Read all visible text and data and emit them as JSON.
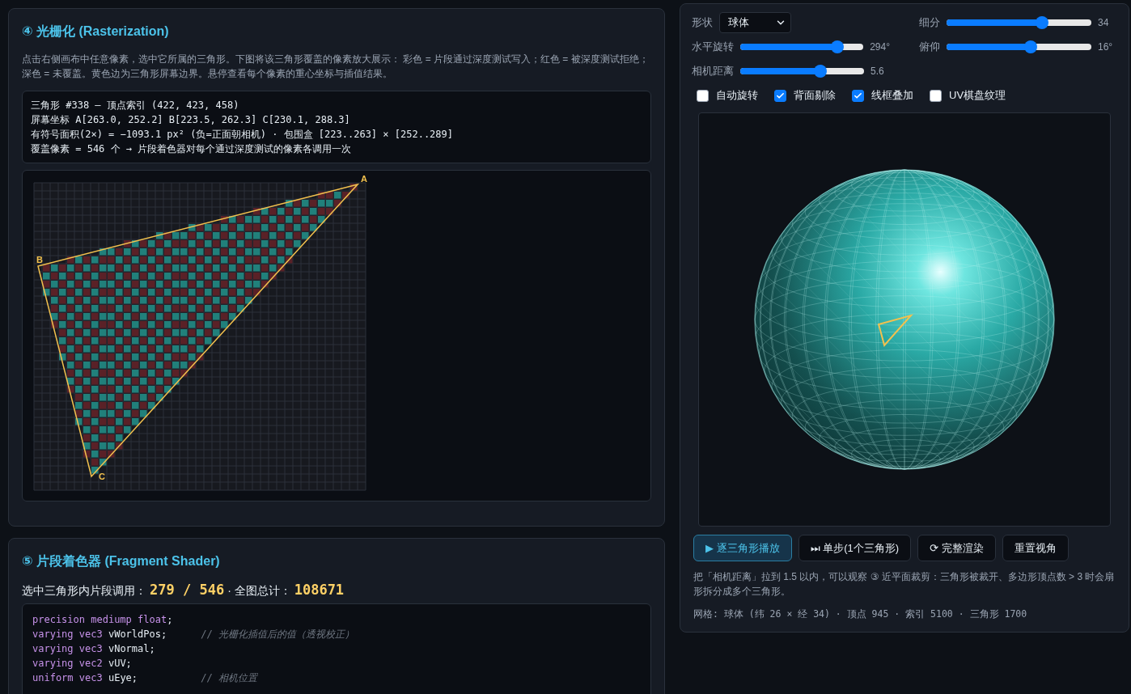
{
  "rasterization": {
    "title": "④ 光栅化 (Rasterization)",
    "description": "点击右侧画布中任意像素，选中它所属的三角形。下图将该三角形覆盖的像素放大展示： 彩色 = 片段通过深度测试写入；红色 = 被深度测试拒绝；深色 = 未覆盖。黄色边为三角形屏幕边界。悬停查看每个像素的重心坐标与插值结果。",
    "info_lines": [
      "三角形 #338 — 顶点索引 (422, 423, 458)",
      "屏幕坐标 A[263.0, 252.2] B[223.5, 262.3] C[230.1, 288.3]",
      "有符号面积(2×) = −1093.1 px² (负=正面朝相机) · 包围盒 [223..263] × [252..289]",
      "覆盖像素 = 546 个 → 片段着色器对每个通过深度测试的像素各调用一次"
    ],
    "vertex_labels": [
      "A",
      "B",
      "C"
    ]
  },
  "fragment_shader": {
    "title": "⑤ 片段着色器 (Fragment Shader)",
    "stats": [
      {
        "kind": "label",
        "text": "选中三角形内片段调用："
      },
      {
        "kind": "value",
        "text": "279 / 546"
      },
      {
        "kind": "label",
        "text": "· 全图总计："
      },
      {
        "kind": "value",
        "text": "108671"
      }
    ],
    "code_lines": [
      {
        "keywords": "precision mediump float",
        "code": ";"
      },
      {
        "keywords": "varying vec3",
        "code": " vWorldPos;",
        "comment": "// 光栅化插值后的值（透视校正）"
      },
      {
        "keywords": "varying vec3",
        "code": " vNormal;"
      },
      {
        "keywords": "varying vec2",
        "code": " vUV;"
      },
      {
        "keywords": "uniform vec3",
        "code": " uEye;",
        "comment": "// 相机位置"
      }
    ]
  },
  "controls": {
    "shape": {
      "label": "形状",
      "value": "球体"
    },
    "sliders": [
      {
        "label": "细分",
        "level": 0.66,
        "reading": "34"
      },
      {
        "label": "水平旋转",
        "level": 0.79,
        "reading": "294°"
      },
      {
        "label": "俯仰",
        "level": 0.58,
        "reading": "16°"
      },
      {
        "label": "相机距离",
        "level": 0.65,
        "reading": "5.6"
      }
    ],
    "checkboxes": [
      {
        "label": "自动旋转",
        "checked": false
      },
      {
        "label": "背面剔除",
        "checked": true
      },
      {
        "label": "线框叠加",
        "checked": true
      },
      {
        "label": "UV棋盘纹理",
        "checked": false
      }
    ]
  },
  "buttons": [
    {
      "label": "▶ 逐三角形播放",
      "selected": true
    },
    {
      "label": "⏭ 单步(1个三角形)",
      "selected": false
    },
    {
      "label": "⟳ 完整渲染",
      "selected": false
    },
    {
      "label": "重置视角",
      "selected": false
    }
  ],
  "note": "把「相机距离」拉到 1.5 以内，可以观察 ③ 近平面裁剪：三角形被裁开、多边形顶点数 > 3 时会扇形拆分成多个三角形。",
  "mesh_info": "网格: 球体 (纬 26 × 经 34) · 顶点 945 · 索引 5100 · 三角形 1700"
}
